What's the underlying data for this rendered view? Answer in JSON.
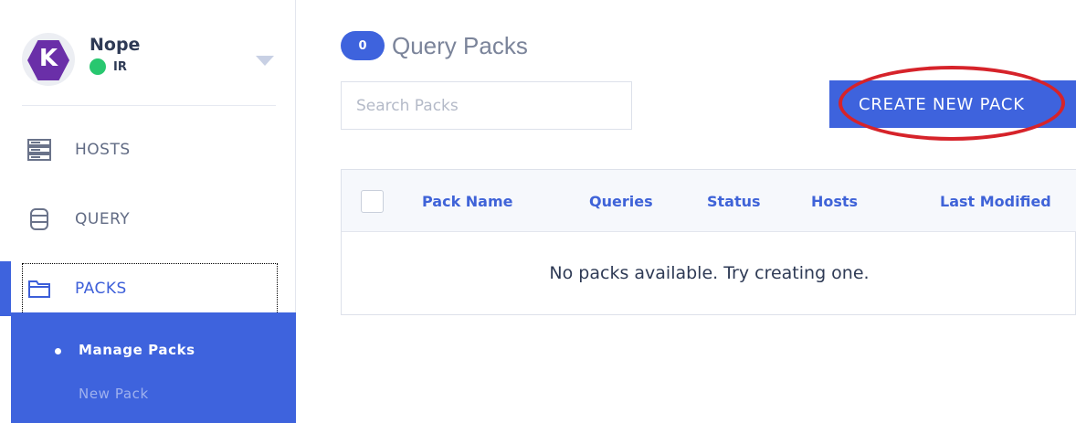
{
  "account": {
    "name": "Nope",
    "team": "IR",
    "avatar_letter": "K",
    "status_color": "#28c76f",
    "avatar_color": "#6a2fa8"
  },
  "nav": {
    "items": [
      {
        "label": "HOSTS",
        "icon": "hosts-icon"
      },
      {
        "label": "QUERY",
        "icon": "database-icon"
      },
      {
        "label": "PACKS",
        "icon": "folder-icon",
        "active": true
      }
    ],
    "submenu": [
      {
        "label": "Manage Packs",
        "active": true
      },
      {
        "label": "New Pack"
      }
    ]
  },
  "main": {
    "count": "0",
    "title": "Query Packs",
    "search_placeholder": "Search Packs",
    "create_button": "CREATE NEW PACK",
    "accent_color": "#3e63dd",
    "annotation_color": "#d6232a",
    "table": {
      "columns": [
        "Pack Name",
        "Queries",
        "Status",
        "Hosts",
        "Last Modified"
      ],
      "empty_message": "No packs available. Try creating one."
    }
  }
}
